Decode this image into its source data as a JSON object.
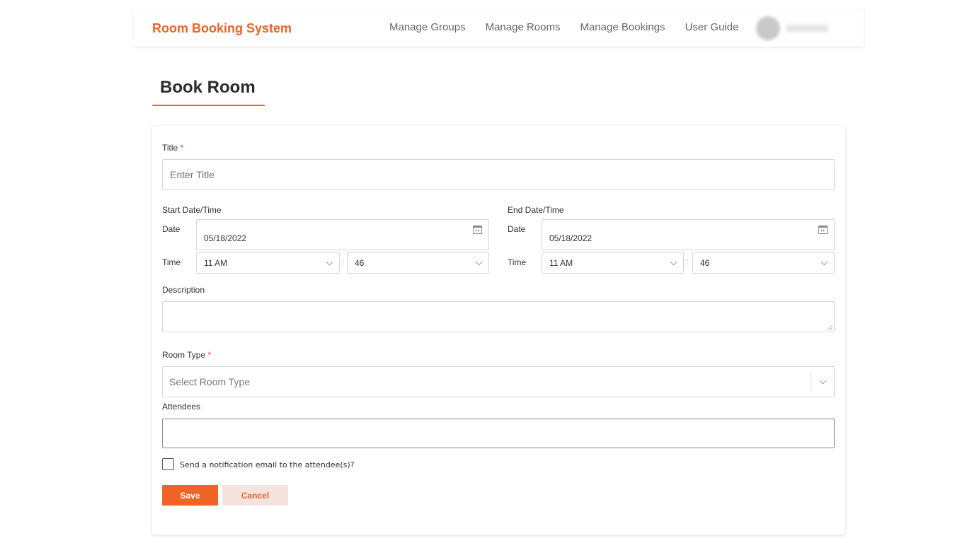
{
  "header": {
    "brand": "Room Booking System",
    "nav": [
      "Manage Groups",
      "Manage Rooms",
      "Manage Bookings",
      "User Guide"
    ]
  },
  "page": {
    "title": "Book Room"
  },
  "form": {
    "title_label": "Title",
    "required_mark": "*",
    "title_placeholder": "Enter Title",
    "start_section": "Start Date/Time",
    "end_section": "End Date/Time",
    "date_label": "Date",
    "time_label": "Time",
    "start_date": "05/18/2022",
    "end_date": "05/18/2022",
    "start_hour": "11 AM",
    "start_minute": "46",
    "end_hour": "11 AM",
    "end_minute": "46",
    "time_separator": ":",
    "description_label": "Description",
    "room_type_label": "Room Type",
    "room_type_placeholder": "Select Room Type",
    "attendees_label": "Attendees",
    "notify_label": "Send a notification email to the attendee(s)?",
    "save_label": "Save",
    "cancel_label": "Cancel"
  },
  "colors": {
    "accent": "#ee6326",
    "cancel_bg": "#f7e3dd",
    "required": "#e53935"
  }
}
